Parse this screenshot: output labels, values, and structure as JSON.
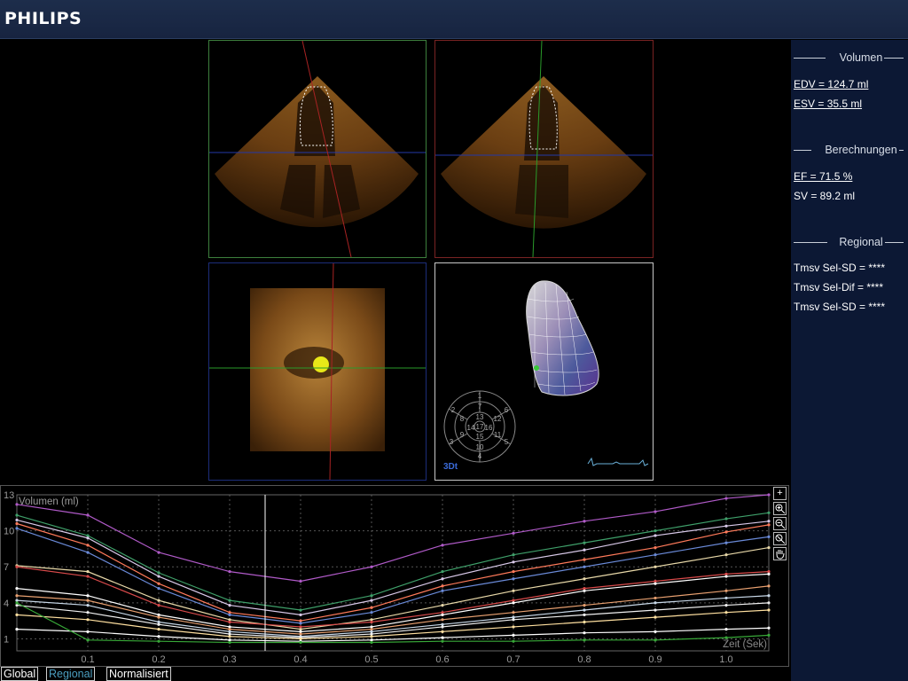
{
  "header": {
    "brand": "PHILIPS"
  },
  "panel": {
    "volumen_title": "Volumen",
    "edv": "EDV = 124.7 ml",
    "esv": "ESV = 35.5 ml",
    "berechnungen_title": "Berechnungen",
    "ef": "EF = 71.5 %",
    "sv": "SV = 89.2 ml",
    "regional_title": "Regional",
    "tmsv1": "Tmsv Sel-SD = ****",
    "tmsv2": "Tmsv Sel-Dif = ****",
    "tmsv3": "Tmsv Sel-SD = ****"
  },
  "viewports": {
    "model_label": "3Dt",
    "bullseye_labels": [
      "1",
      "2",
      "3",
      "4",
      "5",
      "6",
      "7",
      "8",
      "9",
      "10",
      "11",
      "12",
      "13",
      "14",
      "15",
      "16",
      "17"
    ]
  },
  "chart_toolbar": [
    "+",
    "zoom-in",
    "zoom-out",
    "zoom-fit",
    "pan"
  ],
  "tabs": {
    "global": "Global",
    "regional": "Regional",
    "normalisiert": "Normalisiert",
    "active": "regional"
  },
  "chart_data": {
    "type": "line",
    "title": "",
    "ylabel": "Volumen (ml)",
    "xlabel": "Zeit (Sek)",
    "xlim": [
      0,
      1.06
    ],
    "ylim": [
      0,
      13
    ],
    "x_ticks": [
      "0.1",
      "0.2",
      "0.3",
      "0.4",
      "0.5",
      "0.6",
      "0.7",
      "0.8",
      "0.9",
      "1.0"
    ],
    "y_ticks": [
      "1",
      "4",
      "7",
      "10",
      "13"
    ],
    "cursor_x": 0.35,
    "grid": true,
    "x": [
      0,
      0.1,
      0.2,
      0.3,
      0.4,
      0.5,
      0.6,
      0.7,
      0.8,
      0.9,
      1.0,
      1.06
    ],
    "series": [
      {
        "color": "#b05ac8",
        "values": [
          12.2,
          11.3,
          8.2,
          6.6,
          5.8,
          7.0,
          8.8,
          9.8,
          10.8,
          11.6,
          12.7,
          13.0
        ]
      },
      {
        "color": "#3fa06a",
        "values": [
          11.3,
          9.6,
          6.5,
          4.2,
          3.4,
          4.6,
          6.6,
          8.0,
          9.0,
          10.0,
          11.0,
          11.5
        ]
      },
      {
        "color": "#d8c8e8",
        "values": [
          10.9,
          9.4,
          6.2,
          3.8,
          3.0,
          4.2,
          6.0,
          7.4,
          8.4,
          9.6,
          10.4,
          10.8
        ]
      },
      {
        "color": "#ff7a5a",
        "values": [
          10.6,
          8.8,
          5.6,
          3.2,
          2.5,
          3.6,
          5.4,
          6.6,
          7.6,
          8.6,
          9.9,
          10.5
        ]
      },
      {
        "color": "#6a8ad8",
        "values": [
          10.2,
          8.2,
          5.2,
          3.0,
          2.3,
          3.2,
          5.0,
          6.0,
          7.0,
          8.0,
          9.0,
          9.5
        ]
      },
      {
        "color": "#e8d8a8",
        "values": [
          7.1,
          6.6,
          4.2,
          2.6,
          1.8,
          2.6,
          3.8,
          5.0,
          6.0,
          7.0,
          8.0,
          8.6
        ]
      },
      {
        "color": "#d84a4a",
        "values": [
          7.0,
          6.2,
          3.8,
          2.4,
          2.0,
          2.4,
          3.2,
          4.2,
          5.2,
          5.8,
          6.4,
          6.6
        ]
      },
      {
        "color": "#ffffff",
        "values": [
          5.2,
          4.6,
          3.0,
          2.0,
          1.6,
          2.0,
          3.0,
          4.0,
          5.0,
          5.6,
          6.2,
          6.4
        ]
      },
      {
        "color": "#e8a070",
        "values": [
          4.6,
          4.2,
          2.8,
          1.8,
          1.4,
          1.8,
          2.6,
          3.2,
          3.8,
          4.4,
          5.0,
          5.4
        ]
      },
      {
        "color": "#c8d8e8",
        "values": [
          4.2,
          3.8,
          2.4,
          1.6,
          1.2,
          1.6,
          2.2,
          2.8,
          3.4,
          4.0,
          4.4,
          4.6
        ]
      },
      {
        "color": "#f0f0f0",
        "values": [
          3.8,
          3.2,
          2.2,
          1.4,
          1.1,
          1.4,
          2.0,
          2.6,
          3.0,
          3.4,
          3.8,
          4.0
        ]
      },
      {
        "color": "#ffe0a0",
        "values": [
          3.0,
          2.6,
          1.8,
          1.2,
          1.0,
          1.2,
          1.6,
          2.0,
          2.4,
          2.8,
          3.2,
          3.4
        ]
      },
      {
        "color": "#ffffff",
        "values": [
          1.8,
          1.6,
          1.2,
          0.9,
          0.8,
          0.9,
          1.1,
          1.3,
          1.5,
          1.6,
          1.8,
          1.9
        ]
      },
      {
        "color": "#38a838",
        "values": [
          4.0,
          0.9,
          0.8,
          0.7,
          0.7,
          0.7,
          0.8,
          0.8,
          0.9,
          0.9,
          1.1,
          1.3
        ]
      }
    ]
  }
}
